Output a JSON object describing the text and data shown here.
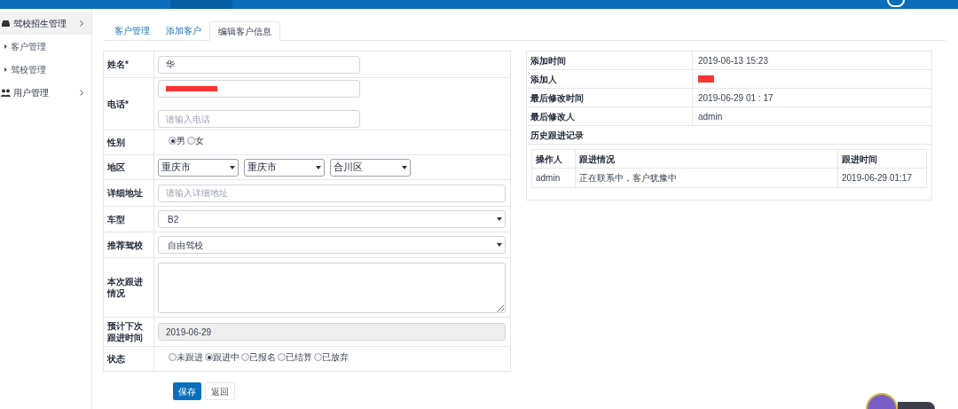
{
  "sidebar": {
    "items": [
      {
        "label": "驾校招生管理",
        "selected": true,
        "children": [
          {
            "label": "客户管理"
          },
          {
            "label": "驾校管理"
          }
        ]
      },
      {
        "label": "用户管理",
        "selected": false
      }
    ]
  },
  "tabs": [
    {
      "label": "客户管理",
      "selected": false
    },
    {
      "label": "添加客户",
      "selected": false
    },
    {
      "label": "编辑客户信息",
      "selected": true
    }
  ],
  "form": {
    "rows": [
      {
        "label": "姓名*",
        "kind": "text",
        "inputs": [
          {
            "value": "华"
          }
        ]
      },
      {
        "label": "电话*",
        "kind": "text",
        "inputs": [
          {
            "redacted": true
          },
          {
            "placeholder": "请输入电话"
          }
        ]
      },
      {
        "label": "性别",
        "kind": "radio",
        "options": [
          {
            "label": "男",
            "selected": true
          },
          {
            "label": "女",
            "selected": false
          }
        ]
      },
      {
        "label": "地区",
        "kind": "selects",
        "selects": [
          "重庆市",
          "重庆市",
          "合川区"
        ]
      },
      {
        "label": "详细地址",
        "kind": "text",
        "wide": true,
        "inputs": [
          {
            "placeholder": "请输入详细地址"
          }
        ]
      },
      {
        "label": "车型",
        "kind": "select",
        "value": "B2"
      },
      {
        "label": "推荐驾校",
        "kind": "select",
        "value": "自由驾校"
      },
      {
        "label": "本次跟进情况",
        "kind": "textarea"
      },
      {
        "label": "预计下次跟进时间",
        "kind": "date",
        "value": "2019-06-29"
      },
      {
        "label": "状态",
        "kind": "radio",
        "options": [
          {
            "label": "未跟进",
            "selected": false
          },
          {
            "label": "跟进中",
            "selected": true
          },
          {
            "label": "已报名",
            "selected": false
          },
          {
            "label": "已结算",
            "selected": false
          },
          {
            "label": "已放弃",
            "selected": false
          }
        ]
      }
    ],
    "buttons": [
      {
        "label": "保存",
        "primary": true
      },
      {
        "label": "返回",
        "primary": false
      }
    ]
  },
  "info": {
    "rows": [
      {
        "label": "添加时间",
        "value": "2019-06-13 15:23"
      },
      {
        "label": "添加人",
        "redacted": true
      },
      {
        "label": "最后修改时间",
        "value": "2019-06-29 01 : 17"
      },
      {
        "label": "最后修改人",
        "value": "admin"
      }
    ],
    "history_title": "历史跟进记录",
    "history": {
      "columns": [
        "操作人",
        "跟进情况",
        "跟进时间"
      ],
      "rows": [
        [
          "admin",
          "正在联系中，客户犹豫中",
          "2019-06-29 01:17"
        ]
      ]
    }
  }
}
